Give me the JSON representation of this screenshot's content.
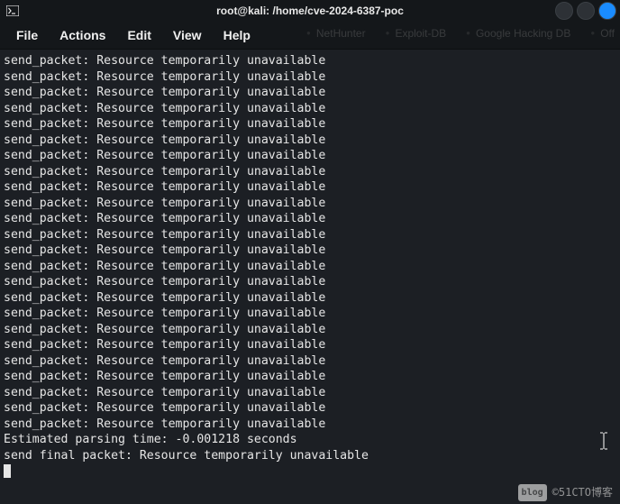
{
  "titlebar": {
    "title": "root@kali: /home/cve-2024-6387-poc"
  },
  "menubar": {
    "items": [
      "File",
      "Actions",
      "Edit",
      "View",
      "Help"
    ],
    "ghost": [
      "NetHunter",
      "Exploit-DB",
      "Google Hacking DB",
      "Off"
    ]
  },
  "terminal": {
    "repeat_line": "send_packet: Resource temporarily unavailable",
    "repeat_count": 24,
    "line_est": "Estimated parsing time: -0.001218 seconds",
    "line_final": "send final packet: Resource temporarily unavailable"
  },
  "watermark": {
    "badge": "blog",
    "text": "©51CTO博客"
  }
}
